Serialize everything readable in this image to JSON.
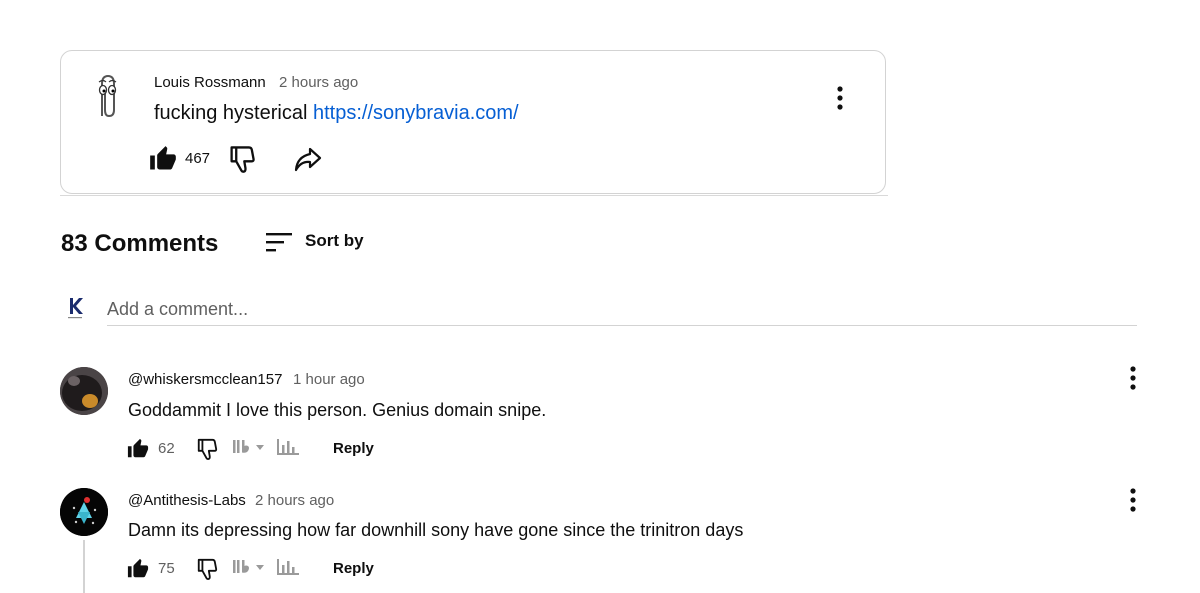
{
  "post": {
    "author": "Louis Rossmann",
    "time": "2 hours ago",
    "text": "fucking hysterical ",
    "link": "https://sonybravia.com/",
    "like_count": "467",
    "icons": [
      "paperclip-avatar-icon",
      "thumbs-up-icon",
      "thumbs-down-icon",
      "share-icon",
      "more-vert-icon"
    ]
  },
  "comments_header": {
    "count_label": "83 Comments",
    "sort_label": "Sort by"
  },
  "add_comment": {
    "placeholder": "Add a comment..."
  },
  "comments": [
    {
      "author": "@whiskersmcclean157",
      "time": "1 hour ago",
      "text": "Goddammit I love this person. Genius domain snipe.",
      "like_count": "62",
      "reply_label": "Reply"
    },
    {
      "author": "@Antithesis-Labs",
      "time": "2 hours ago",
      "text": "Damn its depressing how far downhill sony have gone since the trinitron days",
      "like_count": "75",
      "reply_label": "Reply"
    }
  ],
  "colors": {
    "link": "#065fd4",
    "secondary_text": "#606060",
    "border": "#d3d3d3"
  }
}
